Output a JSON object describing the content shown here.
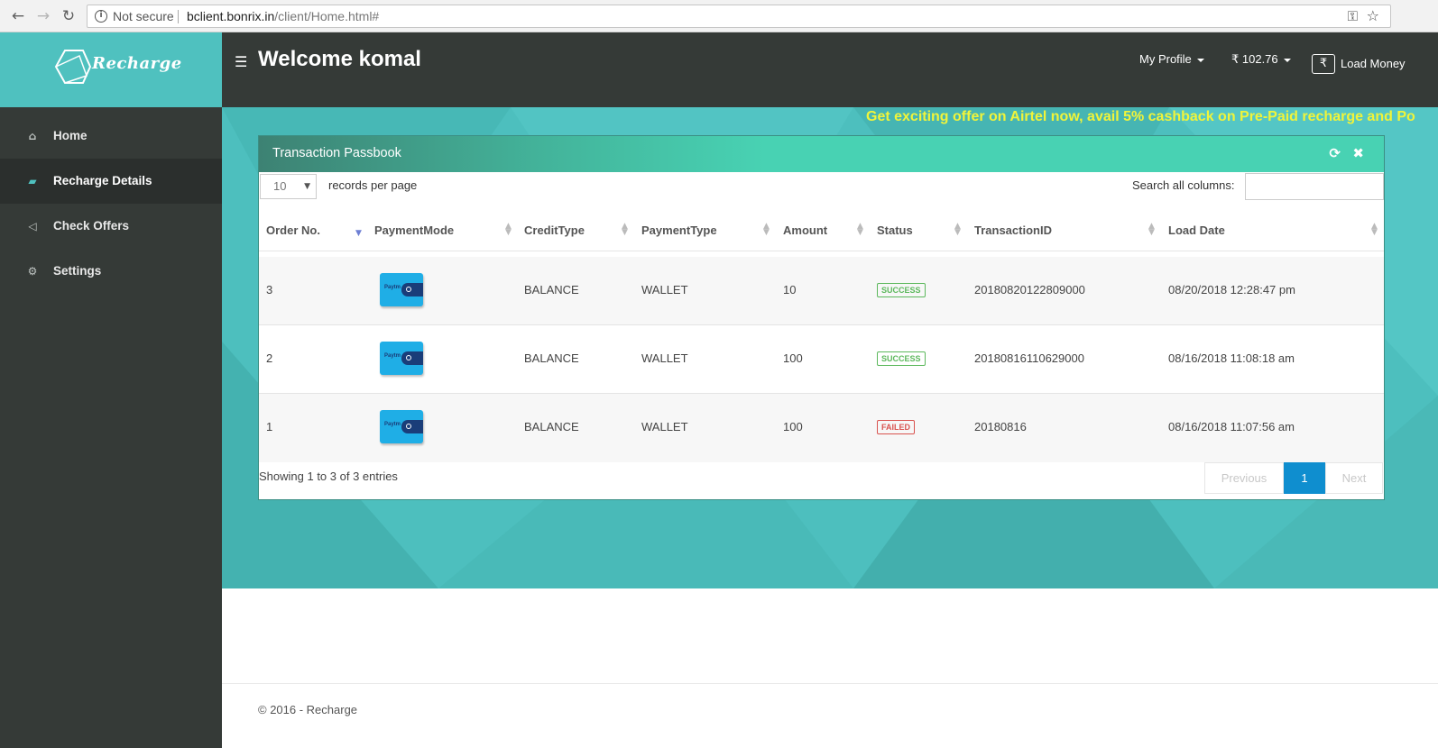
{
  "browser": {
    "not_secure": "Not secure",
    "url_host": "bclient.bonrix.in",
    "url_path": "/client/Home.html#"
  },
  "sidebar": {
    "logo_text": "Recharge",
    "items": [
      {
        "label": "Home",
        "icon": "home-icon"
      },
      {
        "label": "Recharge Details",
        "icon": "book-icon"
      },
      {
        "label": "Check Offers",
        "icon": "megaphone-icon"
      },
      {
        "label": "Settings",
        "icon": "gears-icon"
      }
    ]
  },
  "header": {
    "welcome": "Welcome komal",
    "my_profile": "My Profile",
    "balance": "₹ 102.76",
    "load_money": "Load Money"
  },
  "marquee": "Get exciting offer on Airtel now, avail 5% cashback on Pre-Paid recharge and Po",
  "panel": {
    "title": "Transaction Passbook",
    "records_value": "10",
    "records_label": "records per page",
    "search_label": "Search all columns:",
    "columns": [
      "Order No.",
      "PaymentMode",
      "CreditType",
      "PaymentType",
      "Amount",
      "Status",
      "TransactionID",
      "Load Date"
    ],
    "rows": [
      {
        "order": "3",
        "credit": "BALANCE",
        "ptype": "WALLET",
        "amount": "10",
        "status": "SUCCESS",
        "txn": "20180820122809000",
        "date": "08/20/2018 12:28:47 pm"
      },
      {
        "order": "2",
        "credit": "BALANCE",
        "ptype": "WALLET",
        "amount": "100",
        "status": "SUCCESS",
        "txn": "20180816110629000",
        "date": "08/16/2018 11:08:18 am"
      },
      {
        "order": "1",
        "credit": "BALANCE",
        "ptype": "WALLET",
        "amount": "100",
        "status": "FAILED",
        "txn": "20180816",
        "date": "08/16/2018 11:07:56 am"
      }
    ],
    "paytm_label": "Paytm",
    "info": "Showing 1 to 3 of 3 entries",
    "pager": {
      "prev": "Previous",
      "current": "1",
      "next": "Next"
    }
  },
  "footer": "© 2016 - Recharge",
  "colors": {
    "accent": "#4dbfbe",
    "dark": "#353a37",
    "marquee": "#f0f43a",
    "pager_active": "#0f8ecf"
  }
}
